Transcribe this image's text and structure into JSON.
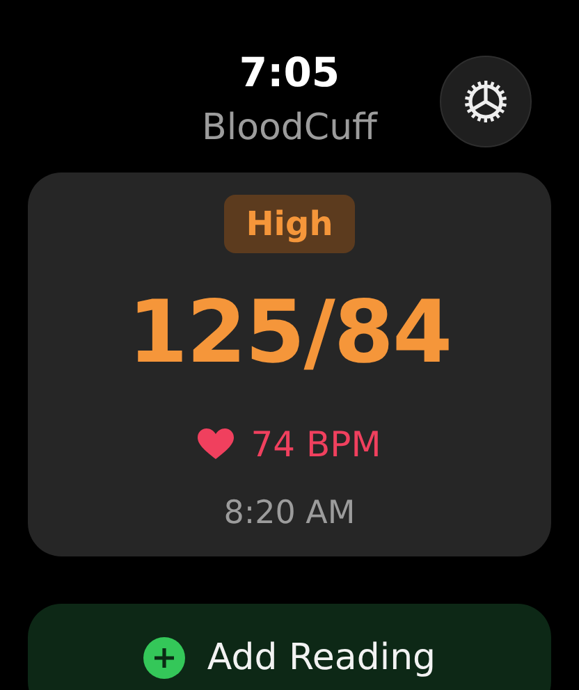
{
  "header": {
    "time": "7:05",
    "app_name": "BloodCuff"
  },
  "reading": {
    "category": {
      "label": "High",
      "kind": "high"
    },
    "value": "125/84",
    "pulse": "74 BPM",
    "taken_at": "8:20 AM"
  },
  "action": {
    "label": "Add Reading"
  }
}
